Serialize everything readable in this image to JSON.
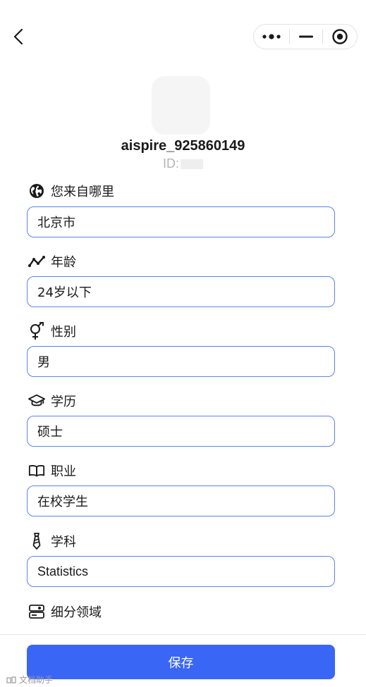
{
  "header": {
    "back_icon": "chevron-left-icon",
    "capsule": {
      "more_icon": "more-dots-icon",
      "minimize_icon": "minimize-icon",
      "close_icon": "target-close-icon"
    }
  },
  "profile": {
    "username": "aispire_925860149",
    "id_label": "ID:"
  },
  "fields": [
    {
      "label": "您来自哪里",
      "icon": "globe-icon",
      "value": "北京市"
    },
    {
      "label": "年龄",
      "icon": "trend-line-icon",
      "value": "24岁以下"
    },
    {
      "label": "性别",
      "icon": "gender-icon",
      "value": "男"
    },
    {
      "label": "学历",
      "icon": "graduation-cap-icon",
      "value": "硕士"
    },
    {
      "label": "职业",
      "icon": "open-book-icon",
      "value": "在校学生"
    },
    {
      "label": "学科",
      "icon": "tie-icon",
      "value": "Statistics"
    },
    {
      "label": "细分领域",
      "icon": "id-card-icon"
    }
  ],
  "footer": {
    "save_label": "保存"
  },
  "watermark": {
    "text": "文档助手",
    "icon": "watermark-logo-icon"
  },
  "colors": {
    "accent": "#3a66f5",
    "input_border": "#5c83e6",
    "muted_text": "#b5b5b5"
  }
}
